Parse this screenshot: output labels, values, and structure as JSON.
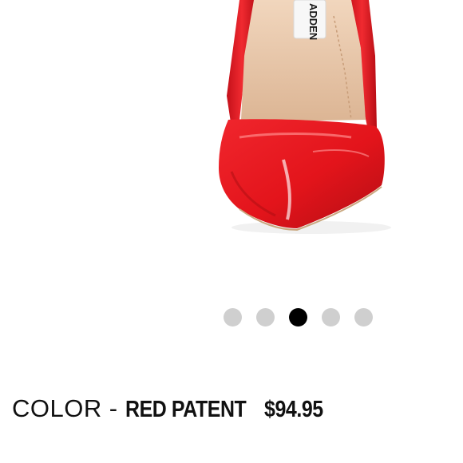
{
  "product_image": {
    "alt": "Red patent pointed-toe pump",
    "insole_brand_text": "ADDEN",
    "colors": {
      "patent_red": "#e3141b",
      "patent_highlight": "#ff6a6a",
      "patent_shadow": "#a90d12",
      "lining": "#e8c7a8",
      "label": "#f7f7f7"
    }
  },
  "carousel": {
    "total": 5,
    "active_index": 2,
    "active_color": "#000000",
    "inactive_color": "#cfcfcf"
  },
  "product_info": {
    "color_label": "COLOR",
    "separator": "-",
    "color_value": "RED PATENT",
    "price": "$94.95"
  }
}
